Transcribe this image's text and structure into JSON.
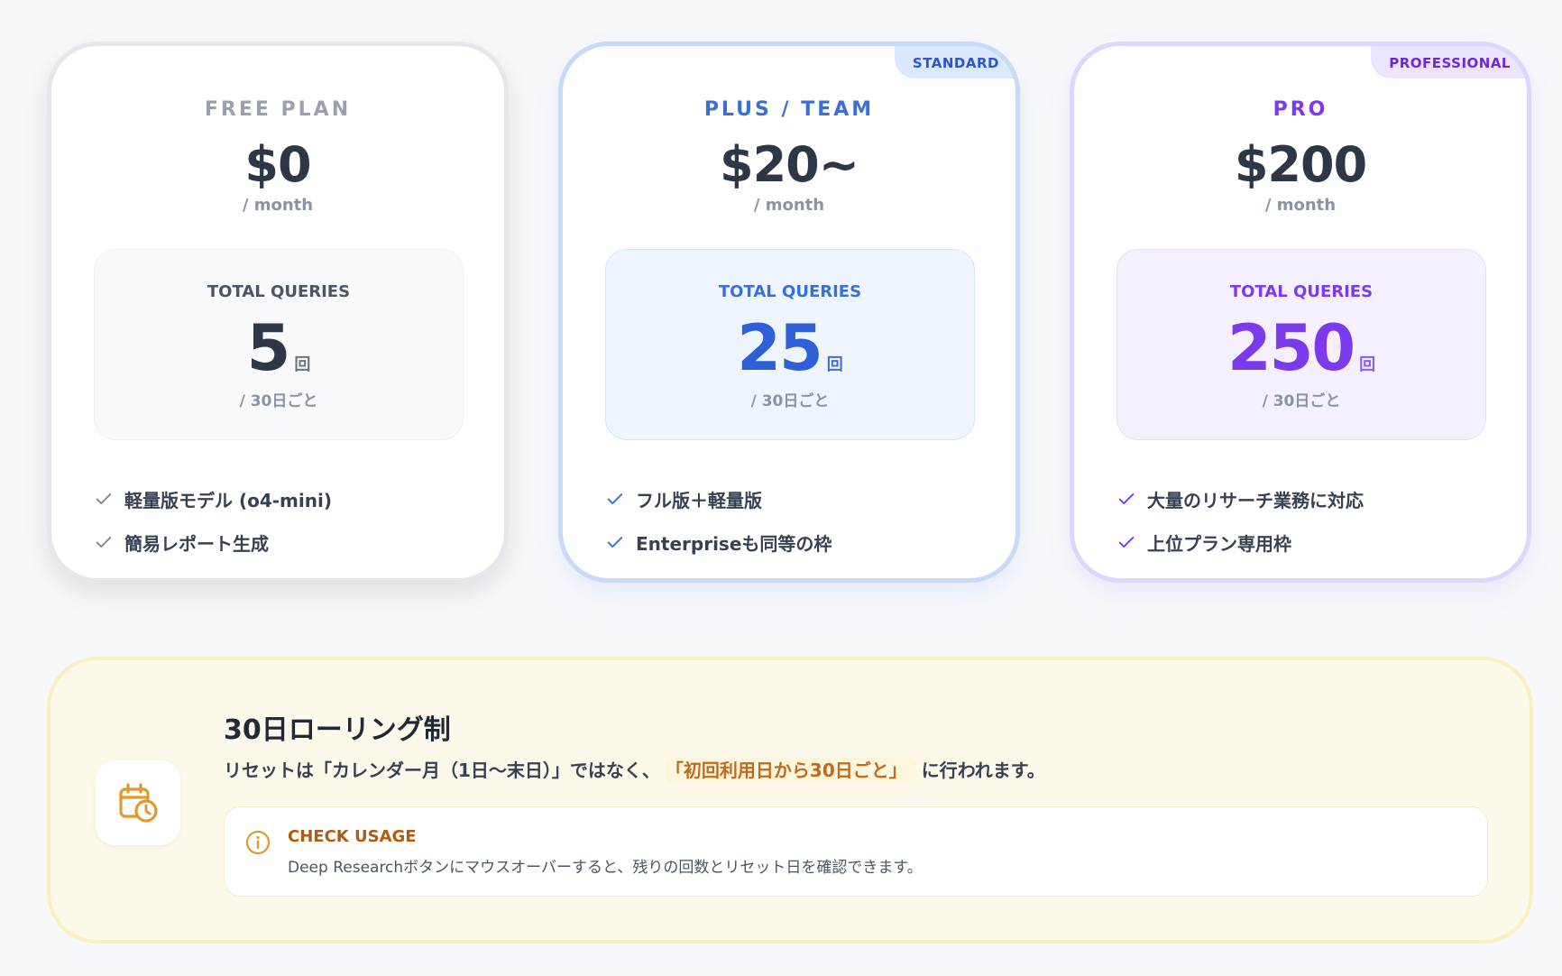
{
  "plans": [
    {
      "name": "FREE PLAN",
      "badge": "",
      "price": "$0",
      "period": "/ month",
      "queries_label": "TOTAL QUERIES",
      "queries_value": "5",
      "queries_unit": "回",
      "queries_period": "/ 30日ごと",
      "features": [
        "軽量版モデル (o4-mini)",
        "簡易レポート生成"
      ],
      "check_color": "#7a8699"
    },
    {
      "name": "PLUS / TEAM",
      "badge": "STANDARD",
      "price": "$20~",
      "period": "/ month",
      "queries_label": "TOTAL QUERIES",
      "queries_value": "25",
      "queries_unit": "回",
      "queries_period": "/ 30日ごと",
      "features": [
        "フル版＋軽量版",
        "Enterpriseも同等の枠"
      ],
      "check_color": "#3b6fd8"
    },
    {
      "name": "PRO",
      "badge": "PROFESSIONAL",
      "price": "$200",
      "period": "/ month",
      "queries_label": "TOTAL QUERIES",
      "queries_value": "250",
      "queries_unit": "回",
      "queries_period": "/ 30日ごと",
      "features": [
        "大量のリサーチ業務に対応",
        "上位プラン専用枠"
      ],
      "check_color": "#7c3aed"
    }
  ],
  "notice": {
    "icon": "calendar-clock-icon",
    "title": "30日ローリング制",
    "desc_before": "リセットは「カレンダー月（1日〜末日）」ではなく、",
    "desc_highlight": "「初回利用日から30日ごと」",
    "desc_after": "に行われます。",
    "usage_icon": "info-icon",
    "usage_title": "CHECK USAGE",
    "usage_text": "Deep Researchボタンにマウスオーバーすると、残りの回数とリセット日を確認できます。"
  },
  "colors": {
    "free_accent": "#9aa1ad",
    "plus_accent": "#3b6fd8",
    "pro_accent": "#7c3aed",
    "notice_accent": "#e09a2b"
  }
}
